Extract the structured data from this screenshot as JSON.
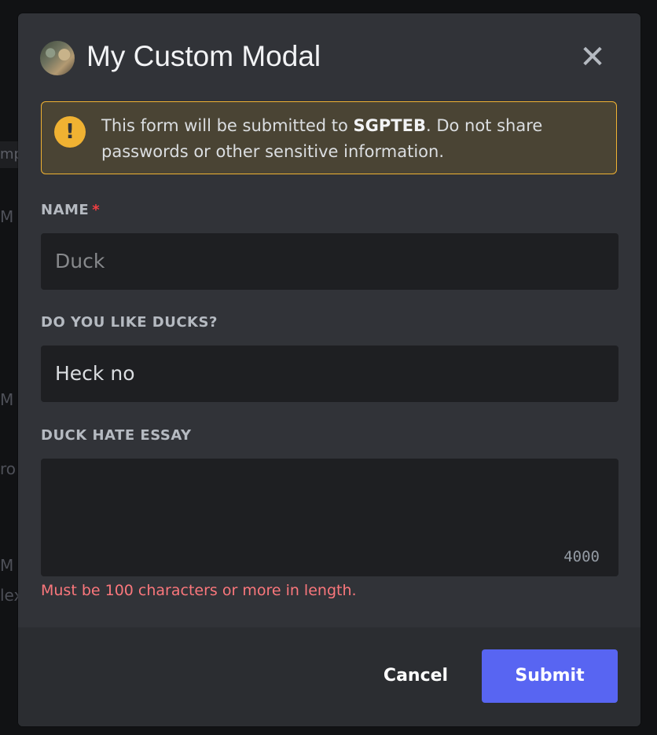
{
  "background": {
    "strip_text": "mp",
    "fragments": [
      "M",
      "M",
      "ro",
      "M",
      "lex"
    ]
  },
  "modal": {
    "title": "My Custom Modal",
    "avatar_icon": "bot-avatar",
    "close_icon": "close-icon",
    "warning": {
      "icon": "exclamation-icon",
      "text_prefix": "This form will be submitted to ",
      "app_name": "SGPTEB",
      "text_suffix": ". Do not share passwords or other sensitive information."
    },
    "fields": [
      {
        "label": "NAME",
        "required_marker": "*",
        "placeholder": "Duck",
        "value": ""
      },
      {
        "label": "DO YOU LIKE DUCKS?",
        "value": "Heck no"
      },
      {
        "label": "DUCK HATE ESSAY",
        "value": "",
        "counter": "4000",
        "error": "Must be 100 characters or more in length."
      }
    ],
    "buttons": {
      "cancel": "Cancel",
      "submit": "Submit"
    }
  },
  "colors": {
    "modal_bg": "#313338",
    "input_bg": "#1e1f22",
    "warning_border": "#f0b232",
    "required": "#f23f42",
    "error": "#fa777c",
    "submit": "#5865f2"
  }
}
